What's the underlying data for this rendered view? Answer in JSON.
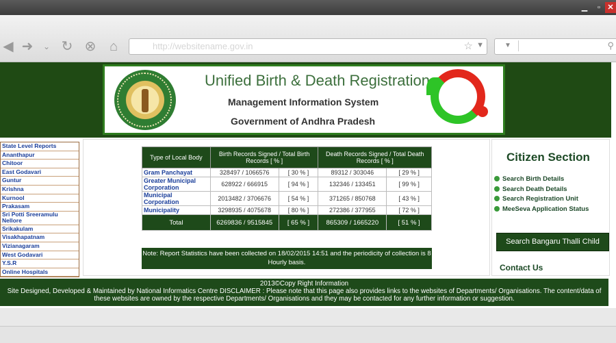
{
  "browser": {
    "window_controls": {
      "minimize": "▁",
      "maximize": "▫",
      "close": "✕"
    },
    "address": "http://websitename.gov.in"
  },
  "banner": {
    "title": "Unified Birth & Death Registration",
    "subtitle": "Management Information System",
    "government": "Government of Andhra Pradesh"
  },
  "sidebar": {
    "items": [
      "State Level Reports",
      "Ananthapur",
      "Chitoor",
      "East Godavari",
      "Guntur",
      "Krishna",
      "Kurnool",
      "Prakasam",
      "Sri Potti Sreeramulu Nellore",
      "Srikakulam",
      "Visakhapatnam",
      "Vizianagaram",
      "West Godavari",
      "Y.S.R",
      "Online Hospitals"
    ]
  },
  "table": {
    "headers": [
      "Type of Local Body",
      "Birth Records Signed / Total Birth Records   [   %   ]",
      "Death Records Signed / Total Death Records   [   %   ]"
    ],
    "rows": [
      {
        "type": "Gram Panchayat",
        "birth": "328497 / 1066576",
        "birth_pct": "[   30  %  ]",
        "death": "89312 / 303046",
        "death_pct": "[   29  %  ]"
      },
      {
        "type": "Greater Municipal Corporation",
        "birth": "628922 / 666915",
        "birth_pct": "[   94  %  ]",
        "death": "132346 / 133451",
        "death_pct": "[   99  %  ]"
      },
      {
        "type": "Municipal Corporation",
        "birth": "2013482 / 3706676",
        "birth_pct": "[   54  %  ]",
        "death": "371265 / 850768",
        "death_pct": "[   43  %  ]"
      },
      {
        "type": "Municipality",
        "birth": "3298935 / 4075678",
        "birth_pct": "[   80  %  ]",
        "death": "272386 / 377955",
        "death_pct": "[   72  %  ]"
      }
    ],
    "total": {
      "label": "Total",
      "birth": "6269836 / 9515845",
      "birth_pct": "[   65  %  ]",
      "death": "865309 / 1665220",
      "death_pct": "[   51  %  ]"
    }
  },
  "note": "Note:  Report Statistics have been collected on    18/02/2015 14:51   and the periodicity of collection is 8 Hourly basis.",
  "citizen": {
    "heading": "Citizen  Section",
    "links": [
      "Search Birth Details",
      "Search Death Details",
      "Search Registration Unit",
      "MeeSeva Application Status"
    ],
    "button": "Search Bangaru Thalli Child",
    "contact": "Contact Us"
  },
  "footer": {
    "line1": "2013©Copy Right Information",
    "line2": "Site Designed, Developed & Maintained by National Informatics Centre DISCLAIMER : Please note that this page also provides links to the websites of Departments/ Organisations. The content/data of these websites are owned by the respective Departments/ Organisations and they may be contacted for any further information or suggestion."
  }
}
